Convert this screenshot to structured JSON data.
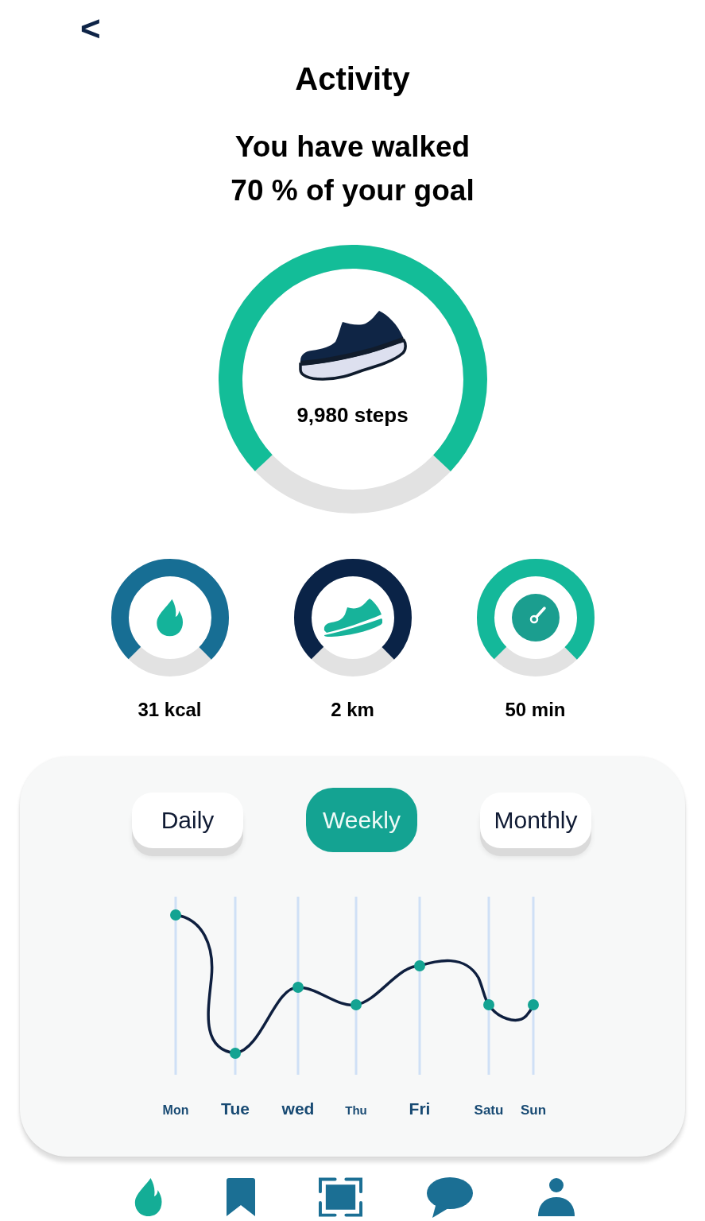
{
  "top_bar": {
    "back": "<"
  },
  "title": "Activity",
  "summary": "You have walked\n70 % of your goal",
  "goal": {
    "steps": "9,980 steps",
    "level": 0.74
  },
  "stats": [
    {
      "value": "31 kcal",
      "level": 0.75,
      "color": "#176e94"
    },
    {
      "value": "2 km",
      "level": 0.75,
      "color": "#0a2347"
    },
    {
      "value": "50 min",
      "level": 0.75,
      "color": "#14b89a"
    }
  ],
  "period_tabs": [
    {
      "label": "Daily",
      "selected": false
    },
    {
      "label": "Weekly",
      "selected": true
    },
    {
      "label": "Monthly",
      "selected": false
    }
  ],
  "chart": {
    "day_labels": [
      "Mon",
      "Tue",
      "wed",
      "Thu",
      "Fri",
      "Satu",
      "Sun"
    ]
  },
  "bottom_nav": [
    {
      "selected": true
    },
    {
      "selected": false
    },
    {
      "selected": false
    },
    {
      "selected": false
    },
    {
      "selected": false
    }
  ]
}
